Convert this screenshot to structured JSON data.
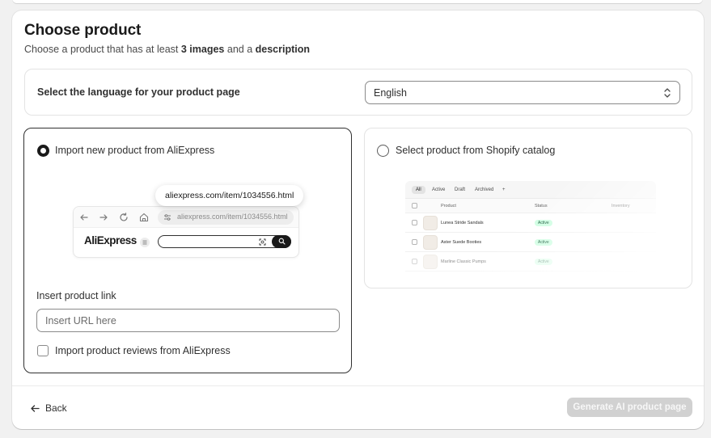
{
  "header": {
    "title": "Choose product",
    "subtitle_prefix": "Choose a product that has at least ",
    "subtitle_bold1": "3 images",
    "subtitle_mid": " and a ",
    "subtitle_bold2": "description"
  },
  "language": {
    "label": "Select the language for your product page",
    "selected": "English"
  },
  "option_aliexpress": {
    "label": "Import new product from AliExpress",
    "selected": true,
    "tooltip_url": "aliexpress.com/item/1034556.html",
    "browser_url": "aliexpress.com/item/1034556.html",
    "logo_text": "AliExpress",
    "link_field_label": "Insert product link",
    "link_placeholder": "Insert URL here",
    "reviews_checkbox_label": "Import product reviews from AliExpress",
    "reviews_checked": false
  },
  "option_shopify": {
    "label": "Select product from Shopify catalog",
    "selected": false,
    "tabs": [
      "All",
      "Active",
      "Draft",
      "Archived",
      "+"
    ],
    "columns": [
      "Product",
      "Status",
      "Inventory"
    ],
    "rows": [
      {
        "name": "Lunea Stride Sandals",
        "status": "Active"
      },
      {
        "name": "Aster Suede Booties",
        "status": "Active"
      },
      {
        "name": "Marline Classic Pumps",
        "status": "Active"
      }
    ]
  },
  "footer": {
    "back_label": "Back",
    "primary_label": "Generate AI product page"
  },
  "colors": {
    "primary_disabled": "#d1d1d1",
    "selected_border": "#303030",
    "badge_bg": "#cdfee1"
  }
}
